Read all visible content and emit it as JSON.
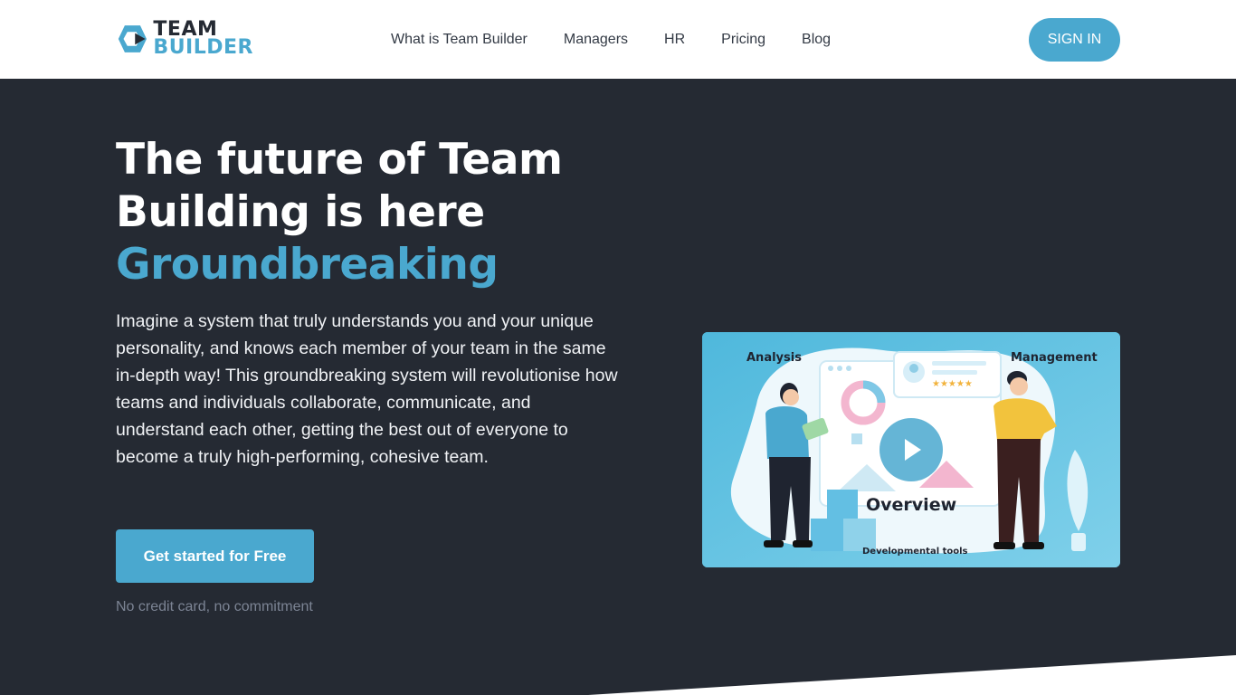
{
  "logo": {
    "line1": "TEAM",
    "line2": "BUILDER"
  },
  "nav": {
    "items": [
      {
        "label": "What is Team Builder"
      },
      {
        "label": "Managers"
      },
      {
        "label": "HR"
      },
      {
        "label": "Pricing"
      },
      {
        "label": "Blog"
      }
    ],
    "signin_label": "SIGN IN"
  },
  "hero": {
    "title": "The future of Team Building is here",
    "accent": "Groundbreaking",
    "description": "Imagine a system that truly understands you and your unique personality, and knows each member of your team in the same in-depth way! This groundbreaking system will revolutionise how teams and individuals collaborate, communicate, and understand each other, getting the best out of everyone to become a truly high-performing, cohesive team.",
    "cta_label": "Get started for Free",
    "cta_note": "No credit card, no commitment"
  },
  "video": {
    "label_analysis": "Analysis",
    "label_management": "Management",
    "label_overview": "Overview",
    "label_tools": "Developmental tools"
  },
  "colors": {
    "accent": "#4aa8cf",
    "dark_bg": "#252a33",
    "header_bg": "#ffffff"
  }
}
